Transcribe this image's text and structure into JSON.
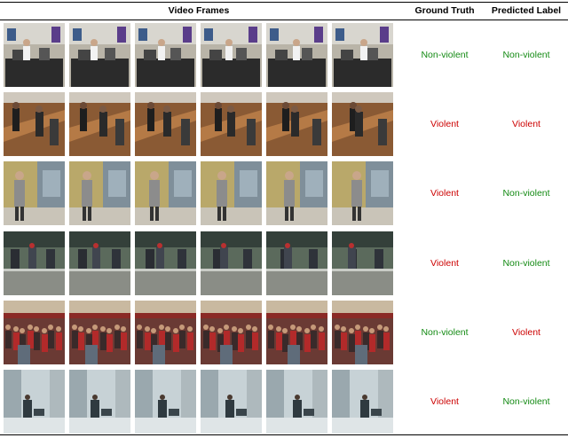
{
  "header": {
    "frames_title": "Video Frames",
    "ground_truth_title": "Ground Truth",
    "predicted_title": "Predicted Label"
  },
  "colors": {
    "violent": "#cc0000",
    "non_violent": "#138a13"
  },
  "rows": [
    {
      "scene": "office",
      "ground_truth": "Non-violent",
      "predicted": "Non-violent",
      "gt_class": "non_violent",
      "pred_class": "non_violent"
    },
    {
      "scene": "cafeteria",
      "ground_truth": "Violent",
      "predicted": "Violent",
      "gt_class": "violent",
      "pred_class": "violent"
    },
    {
      "scene": "corridor",
      "ground_truth": "Violent",
      "predicted": "Non-violent",
      "gt_class": "violent",
      "pred_class": "non_violent"
    },
    {
      "scene": "store",
      "ground_truth": "Violent",
      "predicted": "Non-violent",
      "gt_class": "violent",
      "pred_class": "non_violent"
    },
    {
      "scene": "crowd",
      "ground_truth": "Non-violent",
      "predicted": "Violent",
      "gt_class": "non_violent",
      "pred_class": "violent"
    },
    {
      "scene": "hallway",
      "ground_truth": "Violent",
      "predicted": "Non-violent",
      "gt_class": "violent",
      "pred_class": "non_violent"
    }
  ]
}
